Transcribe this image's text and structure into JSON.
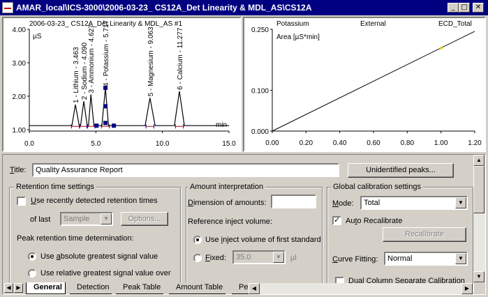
{
  "window": {
    "title": "AMAR_local\\ICS-3000\\2006-03-23_ CS12A_Det Linearity & MDL_AS\\CS12A"
  },
  "chromatogram": {
    "title": "2006-03-23_ CS12A_Det Linearity & MDL_AS #1",
    "y_unit": "µS",
    "x_unit": "min",
    "x_ticks": [
      "0.0",
      "5.0",
      "10.0",
      "15.0"
    ],
    "y_ticks": [
      "1.00",
      "2.00",
      "3.00",
      "4.00"
    ],
    "peaks": [
      "1 - Lithium - 3.463",
      "2 - Sodium - 4.090",
      "3 - Ammonium - 4.627",
      "4 - Potassium - 5.717",
      "5 - Magnesium - 9.063",
      "6 - Calcium - 11.277"
    ]
  },
  "calibration": {
    "header_left": "Potassium",
    "header_mid": "External",
    "header_right": "ECD_Total",
    "y_label": "Area  [µS*min]",
    "x_ticks": [
      "0.00",
      "0.20",
      "0.40",
      "0.60",
      "0.80",
      "1.00",
      "1.20"
    ],
    "y_ticks": [
      "0.250",
      "0.100",
      "0.000"
    ]
  },
  "chart_data": [
    {
      "type": "line",
      "title": "2006-03-23_ CS12A_Det Linearity & MDL_AS #1",
      "xlabel": "min",
      "ylabel": "µS",
      "xlim": [
        0,
        15
      ],
      "ylim": [
        1,
        4
      ],
      "series": [
        {
          "x": [
            0.0,
            3.2,
            3.463,
            3.75,
            3.85,
            4.09,
            4.35,
            4.45,
            4.627,
            4.85,
            5.45,
            5.717,
            5.95,
            8.7,
            9.063,
            9.45,
            10.9,
            11.277,
            11.65,
            15.0
          ],
          "values": [
            1.12,
            1.12,
            1.75,
            1.12,
            1.12,
            1.85,
            1.12,
            1.12,
            2.05,
            1.12,
            1.12,
            2.25,
            1.12,
            1.12,
            1.95,
            1.12,
            1.12,
            2.15,
            1.12,
            1.12
          ]
        }
      ],
      "peak_labels": [
        "1 - Lithium - 3.463",
        "2 - Sodium - 4.090",
        "3 - Ammonium - 4.627",
        "4 - Potassium - 5.717",
        "5 - Magnesium - 9.063",
        "6 - Calcium - 11.277"
      ],
      "peak_x": [
        3.463,
        4.09,
        4.627,
        5.717,
        9.063,
        11.277
      ]
    },
    {
      "type": "line",
      "title": "Potassium",
      "ylabel": "Area  [µS*min]",
      "xlim": [
        0,
        1.2
      ],
      "ylim": [
        0,
        0.25
      ],
      "x_ticks": [
        "0.00",
        "0.20",
        "0.40",
        "0.60",
        "0.80",
        "1.00",
        "1.20"
      ],
      "y_ticks": [
        "0.250",
        "0.100",
        "0.000"
      ],
      "series": [
        {
          "x": [
            0.0,
            1.2
          ],
          "values": [
            0.0,
            0.245
          ]
        }
      ],
      "points": [
        {
          "x": 1.0,
          "y": 0.204
        }
      ]
    }
  ],
  "form": {
    "title_label": "Title:",
    "title_value": "Quality Assurance Report",
    "unidentified_button": "Unidentified peaks...",
    "retention": {
      "legend": "Retention time settings",
      "use_recent_label": "Use recently detected retention times",
      "of_last_label": "of last",
      "of_last_value": "Sample",
      "options_button": "Options...",
      "peak_rt_label": "Peak retention time determination:",
      "radio_abs_label": "Use absolute greatest signal value",
      "radio_rel_label": "Use relative greatest signal value over"
    },
    "amount": {
      "legend": "Amount interpretation",
      "dimension_label": "Dimension of amounts:",
      "dimension_value": "",
      "ref_volume_label": "Reference inject volume:",
      "radio_first_label": "Use inject volume of first standard",
      "fixed_label": "Fixed:",
      "fixed_value": "35.0",
      "fixed_unit": "µl"
    },
    "global": {
      "legend": "Global calibration settings",
      "mode_label": "Mode:",
      "mode_value": "Total",
      "auto_recal_label": "Auto Recalibrate",
      "recalibrate_button": "Recalibrate",
      "curve_label": "Curve Fitting:",
      "curve_value": "Normal",
      "dual_label": "Dual Column Separate Calibration"
    }
  },
  "tabs": [
    "General",
    "Detection",
    "Peak Table",
    "Amount Table",
    "Pe"
  ],
  "colors": {
    "titlebar": "#000080",
    "trace": "#000000",
    "peak_marker": "#0000c0",
    "baseline": "#c00000"
  }
}
